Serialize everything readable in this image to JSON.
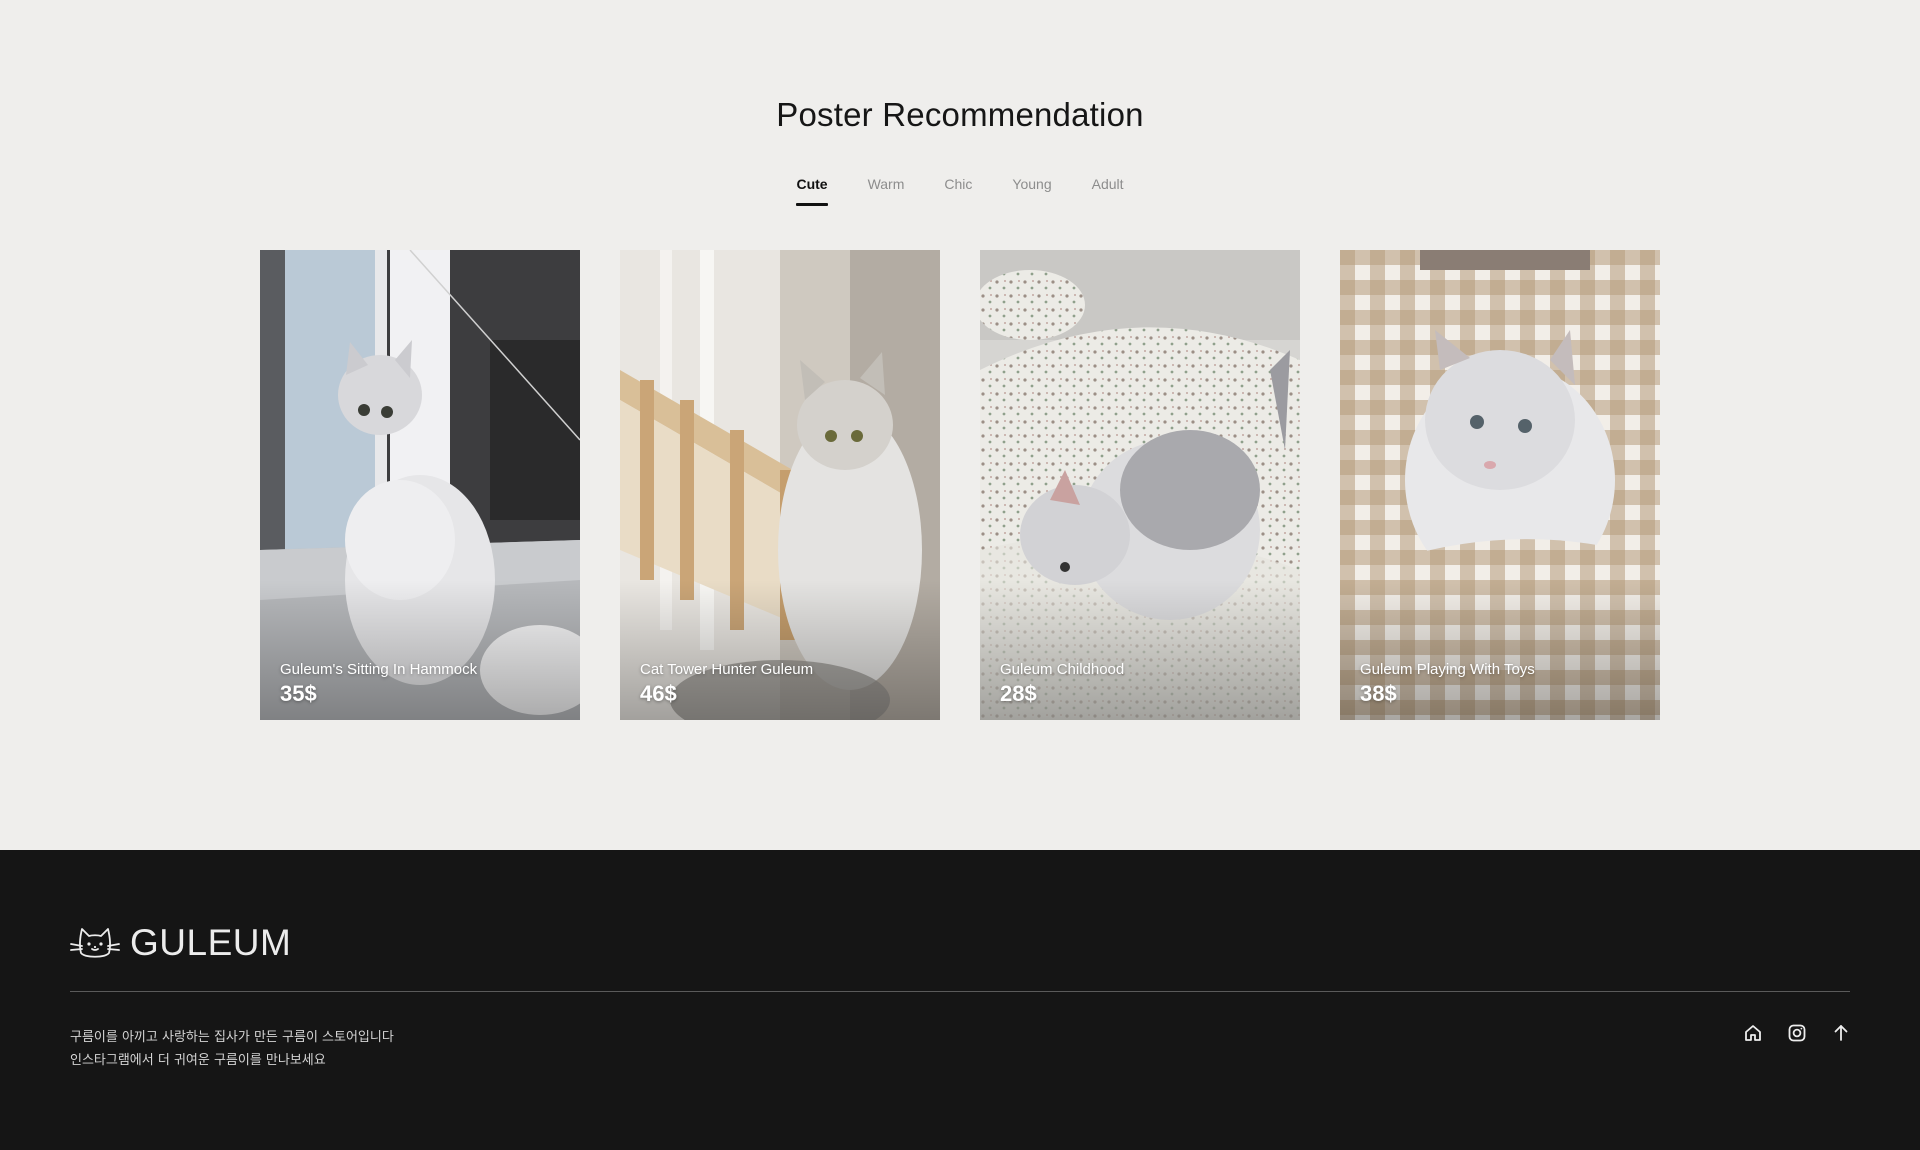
{
  "recommendation": {
    "title": "Poster Recommendation",
    "tabs": [
      {
        "label": "Cute",
        "active": true
      },
      {
        "label": "Warm",
        "active": false
      },
      {
        "label": "Chic",
        "active": false
      },
      {
        "label": "Young",
        "active": false
      },
      {
        "label": "Adult",
        "active": false
      }
    ],
    "cards": [
      {
        "name": "Guleum's Sitting In Hammock",
        "price": "35$"
      },
      {
        "name": "Cat Tower Hunter Guleum",
        "price": "46$"
      },
      {
        "name": "Guleum Childhood",
        "price": "28$"
      },
      {
        "name": "Guleum Playing With Toys",
        "price": "38$"
      }
    ]
  },
  "footer": {
    "brand": "GULEUM",
    "description": [
      "구름이를 아끼고 사랑하는 집사가 만든 구름이 스토어입니다",
      "인스타그램에서 더 귀여운 구름이를 만나보세요"
    ],
    "icons": [
      "home-icon",
      "instagram-icon",
      "arrow-up-icon"
    ]
  },
  "colors": {
    "page_background": "#efeeec",
    "footer_background": "#151515",
    "active_tab": "#111111",
    "inactive_tab": "#8d8d8d"
  }
}
